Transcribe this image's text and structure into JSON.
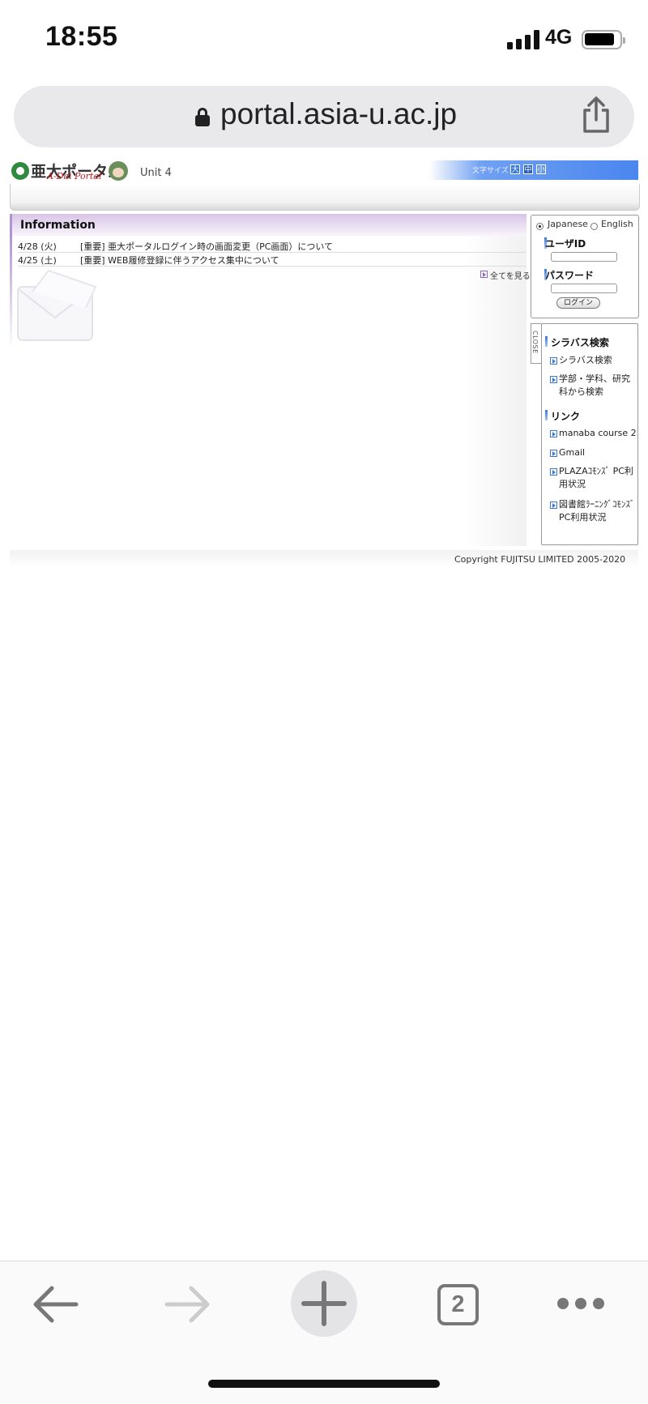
{
  "status_bar": {
    "time": "18:55",
    "network": "4G"
  },
  "browser": {
    "url": "portal.asia-u.ac.jp",
    "tab_count": "2",
    "icons": [
      "lock-icon",
      "share-icon",
      "back-arrow-icon",
      "forward-arrow-icon",
      "plus-icon",
      "more-dots-icon"
    ]
  },
  "portal": {
    "logo_text": "亜大ポータル",
    "logo_subtitle": "A-Dai Portal",
    "unit_label": "Unit 4",
    "font_size": {
      "label": "文字サイズ",
      "large": "大",
      "medium": "中",
      "small": "小"
    },
    "information": {
      "title": "Information",
      "items": [
        {
          "date": "4/28 (火)",
          "text": "[重要] 亜大ポータルログイン時の画面変更（PC画面）について"
        },
        {
          "date": "4/25 (土)",
          "text": "[重要] WEB履修登録に伴うアクセス集中について"
        }
      ],
      "see_all": "全てを見る"
    },
    "login": {
      "lang_japanese": "Japanese",
      "lang_english": "English",
      "selected_lang": "Japanese",
      "user_id_label": "ユーザID",
      "user_id_value": "",
      "password_label": "パスワード",
      "password_value": "",
      "login_button": "ログイン"
    },
    "side_menu": {
      "close_label": "CLOSE",
      "syllabus_title": "シラバス検索",
      "syllabus_items": [
        "シラバス検索",
        "学部・学科、研究科から検索"
      ],
      "links_title": "リンク",
      "link_items": [
        "manaba course 2",
        "Gmail",
        "PLAZAｺﾓﾝｽﾞ PC利用状況",
        "図書館ﾗｰﾆﾝｸﾞｺﾓﾝｽﾞ PC利用状況"
      ]
    },
    "copyright": "Copyright FUJITSU LIMITED 2005-2020"
  },
  "colors": {
    "accent_blue": "#4a86ef",
    "info_purple": "#b094d0",
    "logo_green": "#2f8a3f"
  }
}
